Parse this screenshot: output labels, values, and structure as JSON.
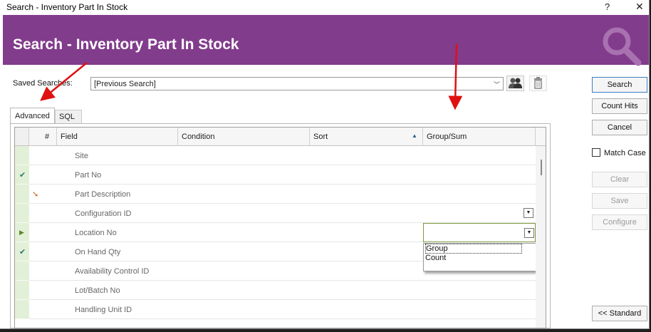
{
  "window": {
    "title": "Search - Inventory Part In Stock",
    "help_glyph": "?",
    "close_glyph": "✕"
  },
  "banner": {
    "title": "Search - Inventory Part In Stock",
    "icon": "magnifier-icon",
    "color": "#823c8c"
  },
  "saved_searches": {
    "label": "Saved Searches:",
    "value": "[Previous Search]"
  },
  "tabs": [
    {
      "label": "Advanced"
    },
    {
      "label": "SQL"
    }
  ],
  "grid": {
    "columns": [
      {
        "label": "#"
      },
      {
        "label": "Field"
      },
      {
        "label": "Condition"
      },
      {
        "label": "Sort"
      },
      {
        "label": "Group/Sum"
      }
    ],
    "rows": [
      {
        "field": "Site",
        "mark": ""
      },
      {
        "field": "Part No",
        "mark": "check"
      },
      {
        "field": "Part Description",
        "mark": "orange-arrow"
      },
      {
        "field": "Configuration ID",
        "mark": ""
      },
      {
        "field": "Location No",
        "mark": "current-row"
      },
      {
        "field": "On Hand Qty",
        "mark": "check"
      },
      {
        "field": "Availability Control ID",
        "mark": ""
      },
      {
        "field": "Lot/Batch No",
        "mark": ""
      },
      {
        "field": "Handling Unit ID",
        "mark": ""
      }
    ],
    "groupsum_dropdown": {
      "options": [
        "Group",
        "Count"
      ],
      "highlighted": "Group"
    }
  },
  "buttons": {
    "search": "Search",
    "count_hits": "Count Hits",
    "cancel": "Cancel",
    "match_case": "Match Case",
    "clear": "Clear",
    "save": "Save",
    "configure": "Configure",
    "standard": "<< Standard"
  },
  "glyphs": {
    "check": "✔",
    "orange_arrow": "➘",
    "current_row": "▶",
    "dropdown_arrow": "▾",
    "sort_up": "▲"
  },
  "colors": {
    "selection_bg": "#e3f0d8",
    "check": "#2a7a6a",
    "annotation_arrow": "#e01010",
    "primary_border": "#3c7dc4"
  }
}
